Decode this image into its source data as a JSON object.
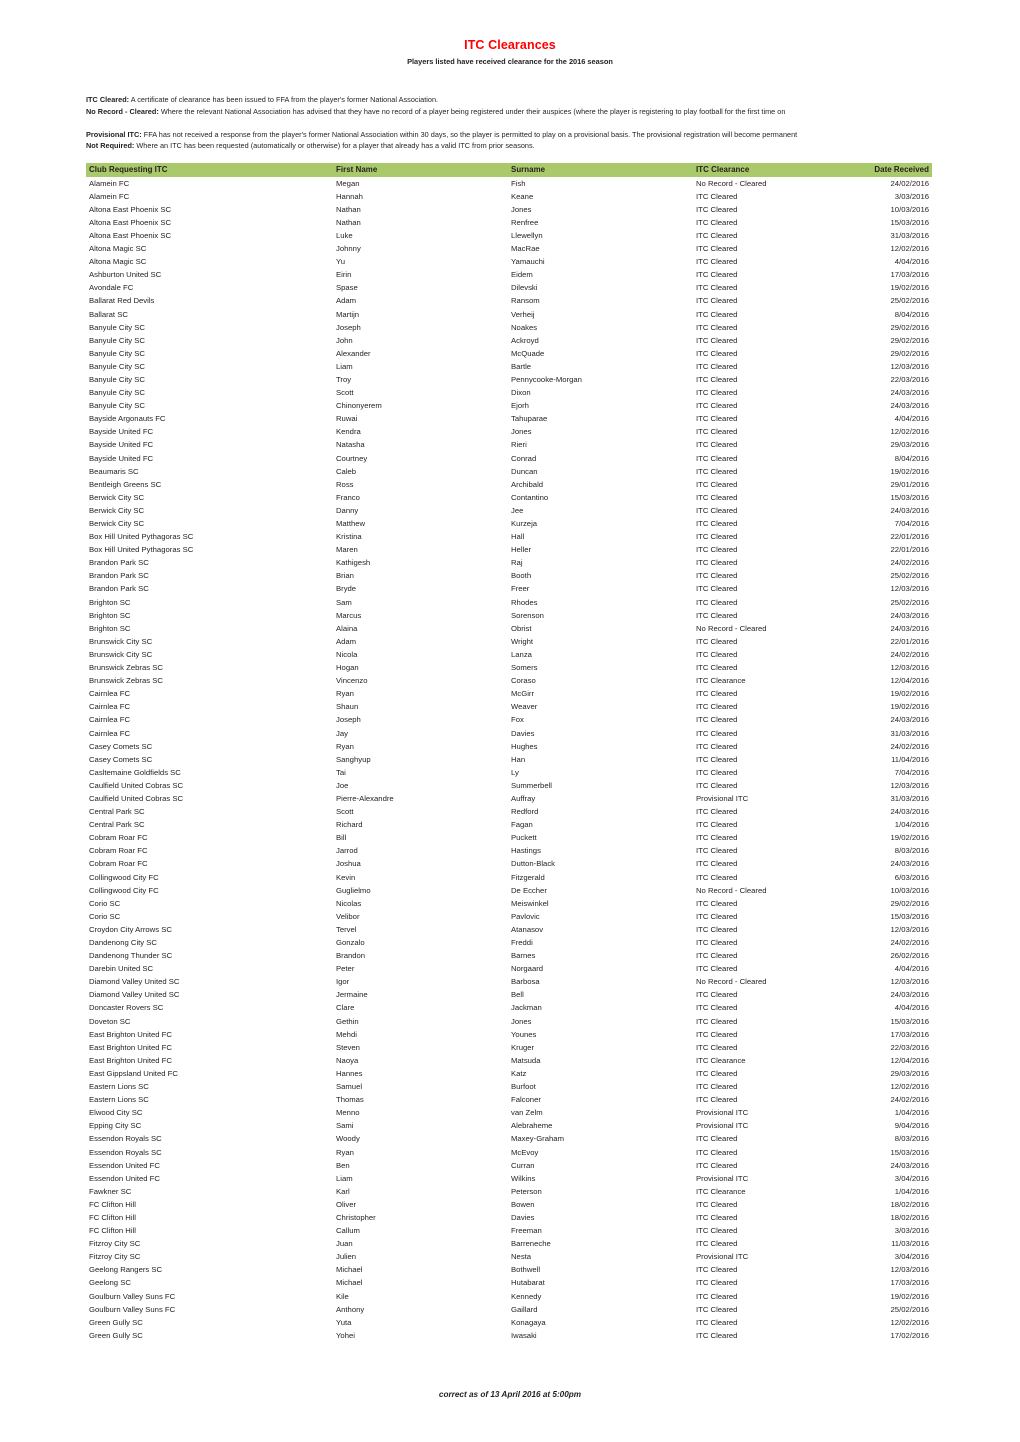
{
  "document": {
    "title": "ITC Clearances",
    "subtitle": "Players listed have received clearance for the 2016 season",
    "title_color": "#FF0000",
    "header_color": "#AAC96B",
    "footer_note": "correct as of 13 April 2016 at 5:00pm"
  },
  "definitions": [
    {
      "term": "ITC Cleared:",
      "text": " A certificate of clearance has been issued to FFA from the player's former National Association."
    },
    {
      "term": "No Record - Cleared:",
      "text": " Where the relevant National Association has advised that they have no record of a player being registered under their auspices (where the player is registering to play football for the first time on"
    },
    {
      "term": "Provisional ITC:",
      "text": " FFA has not received a response from the player's former National Association within 30 days, so the player is permitted to play on a provisional basis. The provisional registration will become permanent"
    },
    {
      "term": "Not Required:",
      "text": " Where an ITC has been requested (automatically or otherwise)  for a player that already has a valid ITC from prior seasons."
    }
  ],
  "table": {
    "columns": [
      "Club Requesting ITC",
      "First Name",
      "Surname",
      "ITC Clearance",
      "Date Received"
    ],
    "rows": [
      [
        "Alamein FC",
        "Megan",
        "Fish",
        "No Record - Cleared",
        "24/02/2016"
      ],
      [
        "Alamein FC",
        "Hannah",
        "Keane",
        "ITC Cleared",
        "3/03/2016"
      ],
      [
        "Altona East Phoenix SC",
        "Nathan",
        "Jones",
        "ITC Cleared",
        "10/03/2016"
      ],
      [
        "Altona East Phoenix SC",
        "Nathan",
        "Renfree",
        "ITC Cleared",
        "15/03/2016"
      ],
      [
        "Altona East Phoenix SC",
        "Luke",
        "Llewellyn",
        "ITC Cleared",
        "31/03/2016"
      ],
      [
        "Altona Magic SC",
        "Johnny",
        "MacRae",
        "ITC Cleared",
        "12/02/2016"
      ],
      [
        "Altona Magic SC",
        "Yu",
        "Yamauchi",
        "ITC Cleared",
        "4/04/2016"
      ],
      [
        "Ashburton United SC",
        "Eirin",
        "Eidem",
        "ITC Cleared",
        "17/03/2016"
      ],
      [
        "Avondale FC",
        "Spase",
        "Dilevski",
        "ITC Cleared",
        "19/02/2016"
      ],
      [
        "Ballarat Red Devils",
        "Adam",
        "Ransom",
        "ITC Cleared",
        "25/02/2016"
      ],
      [
        "Ballarat SC",
        "Martijn",
        "Verheij",
        "ITC Cleared",
        "8/04/2016"
      ],
      [
        "Banyule City SC",
        "Joseph",
        "Noakes",
        "ITC Cleared",
        "29/02/2016"
      ],
      [
        "Banyule City SC",
        "John",
        "Ackroyd",
        "ITC Cleared",
        "29/02/2016"
      ],
      [
        "Banyule City SC",
        "Alexander",
        "McQuade",
        "ITC Cleared",
        "29/02/2016"
      ],
      [
        "Banyule City SC",
        "Liam",
        "Bartle",
        "ITC Cleared",
        "12/03/2016"
      ],
      [
        "Banyule City SC",
        "Troy",
        "Pennycooke-Morgan",
        "ITC Cleared",
        "22/03/2016"
      ],
      [
        "Banyule City SC",
        "Scott",
        "Dixon",
        "ITC Cleared",
        "24/03/2016"
      ],
      [
        "Banyule City SC",
        "Chinonyerem",
        "Ejorh",
        "ITC Cleared",
        "24/03/2016"
      ],
      [
        "Bayside Argonauts FC",
        "Ruwai",
        "Tahuparae",
        "ITC Cleared",
        "4/04/2016"
      ],
      [
        "Bayside United FC",
        "Kendra",
        "Jones",
        "ITC Cleared",
        "12/02/2016"
      ],
      [
        "Bayside United FC",
        "Natasha",
        "Rieri",
        "ITC Cleared",
        "29/03/2016"
      ],
      [
        "Bayside United FC",
        "Courtney",
        "Conrad",
        "ITC Cleared",
        "8/04/2016"
      ],
      [
        "Beaumaris SC",
        "Caleb",
        "Duncan",
        "ITC Cleared",
        "19/02/2016"
      ],
      [
        "Bentleigh Greens SC",
        "Ross",
        "Archibald",
        "ITC Cleared",
        "29/01/2016"
      ],
      [
        "Berwick City SC",
        "Franco",
        "Contantino",
        "ITC Cleared",
        "15/03/2016"
      ],
      [
        "Berwick City SC",
        "Danny",
        "Jee",
        "ITC Cleared",
        "24/03/2016"
      ],
      [
        "Berwick City SC",
        "Matthew",
        "Kurzeja",
        "ITC Cleared",
        "7/04/2016"
      ],
      [
        "Box Hill United Pythagoras SC",
        "Kristina",
        "Hall",
        "ITC Cleared",
        "22/01/2016"
      ],
      [
        "Box Hill United Pythagoras SC",
        "Maren",
        "Heller",
        "ITC Cleared",
        "22/01/2016"
      ],
      [
        "Brandon Park SC",
        "Kathigesh",
        "Raj",
        "ITC Cleared",
        "24/02/2016"
      ],
      [
        "Brandon Park SC",
        "Brian",
        "Booth",
        "ITC Cleared",
        "25/02/2016"
      ],
      [
        "Brandon Park SC",
        "Bryde",
        "Freer",
        "ITC Cleared",
        "12/03/2016"
      ],
      [
        "Brighton SC",
        "Sam",
        "Rhodes",
        "ITC Cleared",
        "25/02/2016"
      ],
      [
        "Brighton SC",
        "Marcus",
        "Sorenson",
        "ITC Cleared",
        "24/03/2016"
      ],
      [
        "Brighton SC",
        "Alaina",
        "Obrist",
        "No Record - Cleared",
        "24/03/2016"
      ],
      [
        "Brunswick City SC",
        "Adam",
        "Wright",
        "ITC Cleared",
        "22/01/2016"
      ],
      [
        "Brunswick City SC",
        "Nicola",
        "Lanza",
        "ITC Cleared",
        "24/02/2016"
      ],
      [
        "Brunswick Zebras SC",
        "Hogan",
        "Somers",
        "ITC Cleared",
        "12/03/2016"
      ],
      [
        "Brunswick Zebras SC",
        "Vincenzo",
        "Coraso",
        "ITC Clearance",
        "12/04/2016"
      ],
      [
        "Cairnlea FC",
        "Ryan",
        "McGirr",
        "ITC Cleared",
        "19/02/2016"
      ],
      [
        "Cairnlea FC",
        "Shaun",
        "Weaver",
        "ITC Cleared",
        "19/02/2016"
      ],
      [
        "Cairnlea FC",
        "Joseph",
        "Fox",
        "ITC Cleared",
        "24/03/2016"
      ],
      [
        "Cairnlea FC",
        "Jay",
        "Davies",
        "ITC Cleared",
        "31/03/2016"
      ],
      [
        "Casey Comets SC",
        "Ryan",
        "Hughes",
        "ITC Cleared",
        "24/02/2016"
      ],
      [
        "Casey Comets SC",
        "Sanghyup",
        "Han",
        "ITC Cleared",
        "11/04/2016"
      ],
      [
        "Casltemaine Goldfields SC",
        "Tai",
        "Ly",
        "ITC Cleared",
        "7/04/2016"
      ],
      [
        "Caulfield United Cobras SC",
        "Joe",
        "Summerbell",
        "ITC Cleared",
        "12/03/2016"
      ],
      [
        "Caulfield United Cobras SC",
        "Pierre-Alexandre",
        "Auffray",
        "Provisional ITC",
        "31/03/2016"
      ],
      [
        "Central Park SC",
        "Scott",
        "Redford",
        "ITC Cleared",
        "24/03/2016"
      ],
      [
        "Central Park SC",
        "Richard",
        "Fagan",
        "ITC Cleared",
        "1/04/2016"
      ],
      [
        "Cobram Roar FC",
        "Bill",
        "Puckett",
        "ITC Cleared",
        "19/02/2016"
      ],
      [
        "Cobram Roar FC",
        "Jarrod",
        "Hastings",
        "ITC Cleared",
        "8/03/2016"
      ],
      [
        "Cobram Roar FC",
        "Joshua",
        "Dutton-Black",
        "ITC Cleared",
        "24/03/2016"
      ],
      [
        "Collingwood City FC",
        "Kevin",
        "Fitzgerald",
        "ITC Cleared",
        "6/03/2016"
      ],
      [
        "Collingwood City FC",
        "Guglielmo",
        "De Eccher",
        "No Record - Cleared",
        "10/03/2016"
      ],
      [
        "Corio SC",
        "Nicolas",
        "Meiswinkel",
        "ITC Cleared",
        "29/02/2016"
      ],
      [
        "Corio SC",
        "Velibor",
        "Pavlovic",
        "ITC Cleared",
        "15/03/2016"
      ],
      [
        "Croydon City Arrows SC",
        "Tervel",
        "Atanasov",
        "ITC Cleared",
        "12/03/2016"
      ],
      [
        "Dandenong City SC",
        "Gonzalo",
        "Freddi",
        "ITC Cleared",
        "24/02/2016"
      ],
      [
        "Dandenong Thunder SC",
        "Brandon",
        "Barnes",
        "ITC Cleared",
        "26/02/2016"
      ],
      [
        "Darebin United SC",
        "Peter",
        "Norgaard",
        "ITC Cleared",
        "4/04/2016"
      ],
      [
        "Diamond Valley United SC",
        "Igor",
        "Barbosa",
        "No Record - Cleared",
        "12/03/2016"
      ],
      [
        "Diamond Valley United SC",
        "Jermaine",
        "Bell",
        "ITC Cleared",
        "24/03/2016"
      ],
      [
        "Doncaster Rovers SC",
        "Clare",
        "Jackman",
        "ITC Cleared",
        "4/04/2016"
      ],
      [
        "Doveton SC",
        "Gethin",
        "Jones",
        "ITC Cleared",
        "15/03/2016"
      ],
      [
        "East Brighton United FC",
        "Mehdi",
        "Younes",
        "ITC Cleared",
        "17/03/2016"
      ],
      [
        "East Brighton United FC",
        "Steven",
        "Kruger",
        "ITC Cleared",
        "22/03/2016"
      ],
      [
        "East Brighton United FC",
        "Naoya",
        "Matsuda",
        "ITC Clearance",
        "12/04/2016"
      ],
      [
        "East Gippsland United FC",
        "Hannes",
        "Katz",
        "ITC Cleared",
        "29/03/2016"
      ],
      [
        "Eastern Lions SC",
        "Samuel",
        "Burfoot",
        "ITC Cleared",
        "12/02/2016"
      ],
      [
        "Eastern Lions SC",
        "Thomas",
        "Falconer",
        "ITC Cleared",
        "24/02/2016"
      ],
      [
        "Elwood City SC",
        "Menno",
        "van Zelm",
        "Provisional ITC",
        "1/04/2016"
      ],
      [
        "Epping City SC",
        "Sami",
        "Alebraheme",
        "Provisional ITC",
        "9/04/2016"
      ],
      [
        "Essendon Royals SC",
        "Woody",
        "Maxey-Graham",
        "ITC Cleared",
        "8/03/2016"
      ],
      [
        "Essendon Royals SC",
        "Ryan",
        "McEvoy",
        "ITC Cleared",
        "15/03/2016"
      ],
      [
        "Essendon United FC",
        "Ben",
        "Curran",
        "ITC Cleared",
        "24/03/2016"
      ],
      [
        "Essendon United FC",
        "Liam",
        "Wilkins",
        "Provisional ITC",
        "3/04/2016"
      ],
      [
        "Fawkner SC",
        "Karl",
        "Peterson",
        "ITC Clearance",
        "1/04/2016"
      ],
      [
        "FC Clifton Hill",
        "Oliver",
        "Bowen",
        "ITC Cleared",
        "18/02/2016"
      ],
      [
        "FC Clifton Hill",
        "Christopher",
        "Davies",
        "ITC Cleared",
        "18/02/2016"
      ],
      [
        "FC Clifton Hill",
        "Callum",
        "Freeman",
        "ITC Cleared",
        "3/03/2016"
      ],
      [
        "Fitzroy City SC",
        "Juan",
        "Barreneche",
        "ITC Cleared",
        "11/03/2016"
      ],
      [
        "Fitzroy City SC",
        "Julien",
        "Nesta",
        "Provisional ITC",
        "3/04/2016"
      ],
      [
        "Geelong Rangers SC",
        "Michael",
        "Bothwell",
        "ITC Cleared",
        "12/03/2016"
      ],
      [
        "Geelong SC",
        "Michael",
        "Hutabarat",
        "ITC Cleared",
        "17/03/2016"
      ],
      [
        "Goulburn Valley Suns FC",
        "Kile",
        "Kennedy",
        "ITC Cleared",
        "19/02/2016"
      ],
      [
        "Goulburn Valley Suns FC",
        "Anthony",
        "Gaillard",
        "ITC Cleared",
        "25/02/2016"
      ],
      [
        "Green Gully SC",
        "Yuta",
        "Konagaya",
        "ITC Cleared",
        "12/02/2016"
      ],
      [
        "Green Gully SC",
        "Yohei",
        "Iwasaki",
        "ITC Cleared",
        "17/02/2016"
      ]
    ]
  }
}
